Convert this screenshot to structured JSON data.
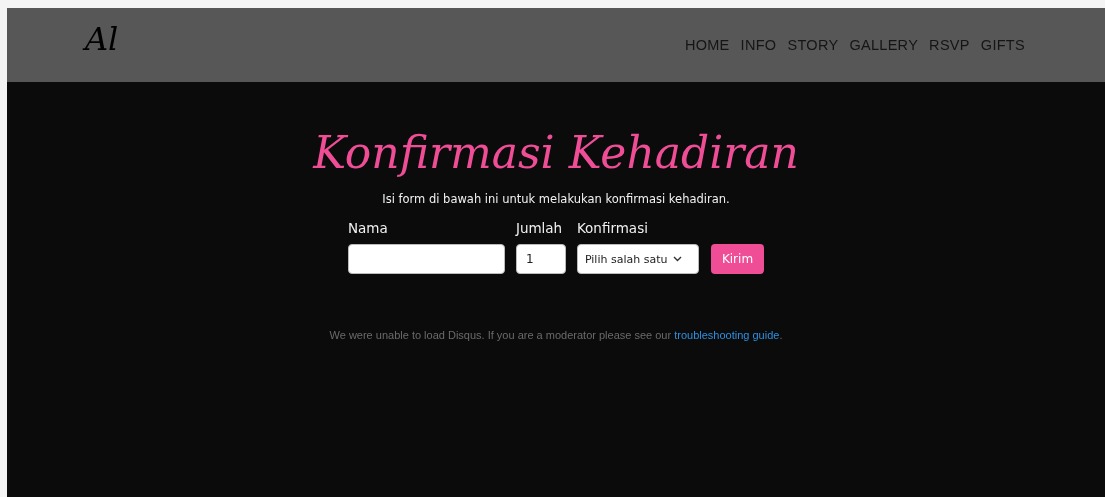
{
  "header": {
    "logo": "Al",
    "nav": [
      {
        "label": "HOME",
        "selected": false
      },
      {
        "label": "INFO",
        "selected": false
      },
      {
        "label": "STORY",
        "selected": false
      },
      {
        "label": "GALLERY",
        "selected": false
      },
      {
        "label": "RSVP",
        "selected": false
      },
      {
        "label": "GIFTS",
        "selected": false
      }
    ]
  },
  "rsvp": {
    "title": "Konfirmasi Kehadiran",
    "subtitle": "Isi form di bawah ini untuk melakukan konfirmasi kehadiran.",
    "fields": [
      {
        "kind": "text",
        "label": "Nama"
      },
      {
        "kind": "number",
        "label": "Jumlah",
        "value": "1"
      },
      {
        "kind": "select",
        "label": "Konfirmasi",
        "value": "Pilih salah satu"
      }
    ],
    "submit": "Kirim"
  },
  "disqus": {
    "text": "We were unable to load Disqus. If you are a moderator please see our",
    "link": "troubleshooting guide",
    "after": "."
  }
}
